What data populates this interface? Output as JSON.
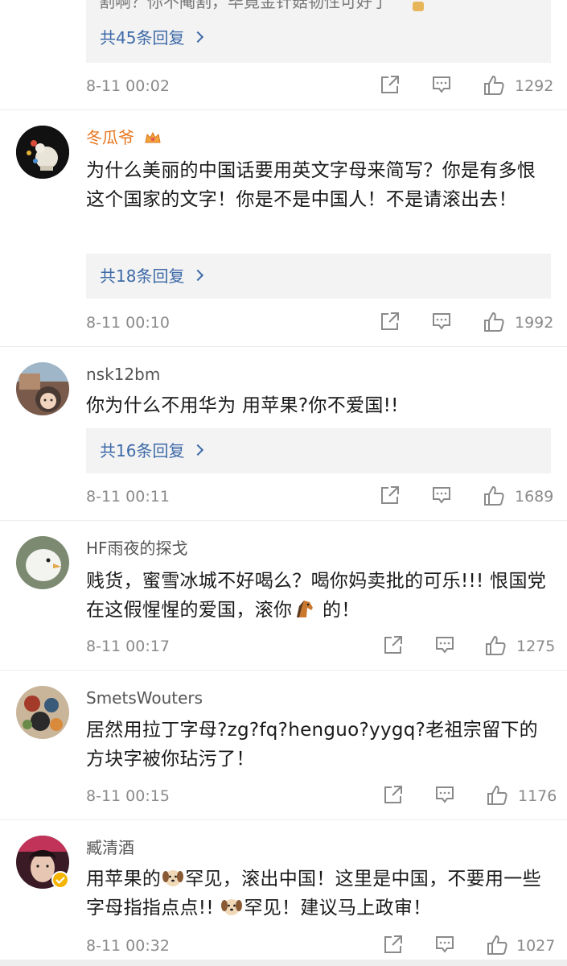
{
  "top_reply": {
    "cut_text": "割啊？你不阉割，毕竟金针菇韧性可好了",
    "replies_label": "共45条回复",
    "timestamp": "8-11 00:02",
    "likes": "1292"
  },
  "comments": [
    {
      "username": "冬瓜爷",
      "vip": true,
      "text": "为什么美丽的中国话要用英文字母来简写？你是有多恨这个国家的文字！你是不是中国人！不是请滚出去！",
      "replies_label": "共18条回复",
      "timestamp": "8-11 00:10",
      "likes": "1992"
    },
    {
      "username": "nsk12bm",
      "vip": false,
      "text": "你为什么不用华为 用苹果?你不爱国!!",
      "replies_label": "共16条回复",
      "timestamp": "8-11 00:11",
      "likes": "1689"
    },
    {
      "username": "HF雨夜的探戈",
      "vip": false,
      "text_before": "贱货，蜜雪冰城不好喝么？喝你妈卖批的可乐!!! 恨国党在这假惺惺的爱国，滚你",
      "text_after": "的！",
      "timestamp": "8-11 00:17",
      "likes": "1275"
    },
    {
      "username": "SmetsWouters",
      "vip": false,
      "text": "居然用拉丁字母?zg?fq?henguo?yygq?老祖宗留下的方块字被你玷污了！",
      "timestamp": "8-11 00:15",
      "likes": "1176"
    },
    {
      "username": "臧清酒",
      "vip": false,
      "verified": true,
      "text_part1": "用苹果的",
      "text_part2": "罕见，滚出中国！这里是中国，不要用一些字母指指点点!! ",
      "text_part3": "罕见！建议马上政审！",
      "timestamp": "8-11 00:32",
      "likes": "1027"
    }
  ],
  "icons": {
    "share": "share-icon",
    "comment": "comment-icon",
    "like": "thumbs-up-icon"
  },
  "colors": {
    "link": "#3d6aa8",
    "vip_name": "#e8761e",
    "meta": "#8a8a8a",
    "reply_bg": "#f3f3f3"
  }
}
